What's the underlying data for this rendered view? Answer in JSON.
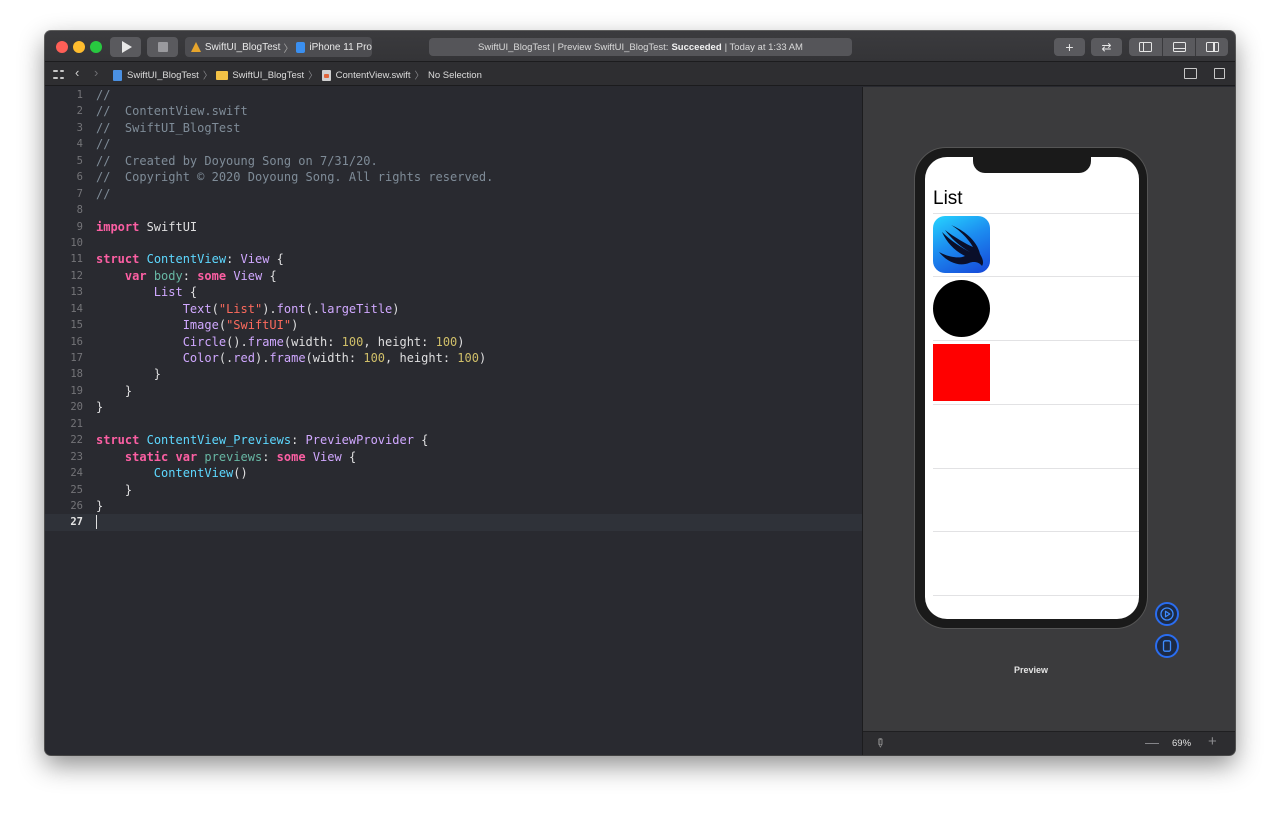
{
  "toolbar": {
    "scheme_project": "SwiftUI_BlogTest",
    "scheme_device": "iPhone 11 Pro",
    "activity_prefix": "SwiftUI_BlogTest | Preview SwiftUI_BlogTest:",
    "activity_status": "Succeeded",
    "activity_time": "| Today at 1:33 AM",
    "plus_label": "+",
    "swap_label": "⇄",
    "colors": {
      "red": "#fe5f57",
      "yellow": "#febc2e",
      "green": "#28c840"
    }
  },
  "jumpbar": {
    "back": "‹",
    "forward": "›",
    "crumbs": [
      "SwiftUI_BlogTest",
      "SwiftUI_BlogTest",
      "ContentView.swift",
      "No Selection"
    ],
    "separator": "〉"
  },
  "editor": {
    "current_line": "27",
    "lines": [
      {
        "n": "1",
        "tokens": [
          {
            "c": "c-comment",
            "t": "//"
          }
        ]
      },
      {
        "n": "2",
        "tokens": [
          {
            "c": "c-comment",
            "t": "//  ContentView.swift"
          }
        ]
      },
      {
        "n": "3",
        "tokens": [
          {
            "c": "c-comment",
            "t": "//  SwiftUI_BlogTest"
          }
        ]
      },
      {
        "n": "4",
        "tokens": [
          {
            "c": "c-comment",
            "t": "//"
          }
        ]
      },
      {
        "n": "5",
        "tokens": [
          {
            "c": "c-comment",
            "t": "//  Created by Doyoung Song on 7/31/20."
          }
        ]
      },
      {
        "n": "6",
        "tokens": [
          {
            "c": "c-comment",
            "t": "//  Copyright © 2020 Doyoung Song. All rights reserved."
          }
        ]
      },
      {
        "n": "7",
        "tokens": [
          {
            "c": "c-comment",
            "t": "//"
          }
        ]
      },
      {
        "n": "8",
        "tokens": []
      },
      {
        "n": "9",
        "tokens": [
          {
            "c": "c-kw",
            "t": "import"
          },
          {
            "c": "c-plain",
            "t": " SwiftUI"
          }
        ]
      },
      {
        "n": "10",
        "tokens": []
      },
      {
        "n": "11",
        "tokens": [
          {
            "c": "c-kw",
            "t": "struct"
          },
          {
            "c": "c-plain",
            "t": " "
          },
          {
            "c": "c-type",
            "t": "ContentView"
          },
          {
            "c": "c-plain",
            "t": ": "
          },
          {
            "c": "c-sys",
            "t": "View"
          },
          {
            "c": "c-plain",
            "t": " {"
          }
        ]
      },
      {
        "n": "12",
        "tokens": [
          {
            "c": "c-plain",
            "t": "    "
          },
          {
            "c": "c-kw",
            "t": "var"
          },
          {
            "c": "c-plain",
            "t": " "
          },
          {
            "c": "c-prop",
            "t": "body"
          },
          {
            "c": "c-plain",
            "t": ": "
          },
          {
            "c": "c-kw",
            "t": "some"
          },
          {
            "c": "c-plain",
            "t": " "
          },
          {
            "c": "c-sys",
            "t": "View"
          },
          {
            "c": "c-plain",
            "t": " {"
          }
        ]
      },
      {
        "n": "13",
        "tokens": [
          {
            "c": "c-plain",
            "t": "        "
          },
          {
            "c": "c-sys",
            "t": "List"
          },
          {
            "c": "c-plain",
            "t": " {"
          }
        ]
      },
      {
        "n": "14",
        "tokens": [
          {
            "c": "c-plain",
            "t": "            "
          },
          {
            "c": "c-sys",
            "t": "Text"
          },
          {
            "c": "c-plain",
            "t": "("
          },
          {
            "c": "c-str",
            "t": "\"List\""
          },
          {
            "c": "c-plain",
            "t": ")."
          },
          {
            "c": "c-sys",
            "t": "font"
          },
          {
            "c": "c-plain",
            "t": "(."
          },
          {
            "c": "c-sys",
            "t": "largeTitle"
          },
          {
            "c": "c-plain",
            "t": ")"
          }
        ]
      },
      {
        "n": "15",
        "tokens": [
          {
            "c": "c-plain",
            "t": "            "
          },
          {
            "c": "c-sys",
            "t": "Image"
          },
          {
            "c": "c-plain",
            "t": "("
          },
          {
            "c": "c-str",
            "t": "\"SwiftUI\""
          },
          {
            "c": "c-plain",
            "t": ")"
          }
        ]
      },
      {
        "n": "16",
        "tokens": [
          {
            "c": "c-plain",
            "t": "            "
          },
          {
            "c": "c-sys",
            "t": "Circle"
          },
          {
            "c": "c-plain",
            "t": "()."
          },
          {
            "c": "c-sys",
            "t": "frame"
          },
          {
            "c": "c-plain",
            "t": "(width: "
          },
          {
            "c": "c-num",
            "t": "100"
          },
          {
            "c": "c-plain",
            "t": ", height: "
          },
          {
            "c": "c-num",
            "t": "100"
          },
          {
            "c": "c-plain",
            "t": ")"
          }
        ]
      },
      {
        "n": "17",
        "tokens": [
          {
            "c": "c-plain",
            "t": "            "
          },
          {
            "c": "c-sys",
            "t": "Color"
          },
          {
            "c": "c-plain",
            "t": "(."
          },
          {
            "c": "c-sys",
            "t": "red"
          },
          {
            "c": "c-plain",
            "t": ")."
          },
          {
            "c": "c-sys",
            "t": "frame"
          },
          {
            "c": "c-plain",
            "t": "(width: "
          },
          {
            "c": "c-num",
            "t": "100"
          },
          {
            "c": "c-plain",
            "t": ", height: "
          },
          {
            "c": "c-num",
            "t": "100"
          },
          {
            "c": "c-plain",
            "t": ")"
          }
        ]
      },
      {
        "n": "18",
        "tokens": [
          {
            "c": "c-plain",
            "t": "        }"
          }
        ]
      },
      {
        "n": "19",
        "tokens": [
          {
            "c": "c-plain",
            "t": "    }"
          }
        ]
      },
      {
        "n": "20",
        "tokens": [
          {
            "c": "c-plain",
            "t": "}"
          }
        ]
      },
      {
        "n": "21",
        "tokens": []
      },
      {
        "n": "22",
        "tokens": [
          {
            "c": "c-kw",
            "t": "struct"
          },
          {
            "c": "c-plain",
            "t": " "
          },
          {
            "c": "c-type",
            "t": "ContentView_Previews"
          },
          {
            "c": "c-plain",
            "t": ": "
          },
          {
            "c": "c-sys",
            "t": "PreviewProvider"
          },
          {
            "c": "c-plain",
            "t": " {"
          }
        ]
      },
      {
        "n": "23",
        "tokens": [
          {
            "c": "c-plain",
            "t": "    "
          },
          {
            "c": "c-kw",
            "t": "static"
          },
          {
            "c": "c-plain",
            "t": " "
          },
          {
            "c": "c-kw",
            "t": "var"
          },
          {
            "c": "c-plain",
            "t": " "
          },
          {
            "c": "c-prop",
            "t": "previews"
          },
          {
            "c": "c-plain",
            "t": ": "
          },
          {
            "c": "c-kw",
            "t": "some"
          },
          {
            "c": "c-plain",
            "t": " "
          },
          {
            "c": "c-sys",
            "t": "View"
          },
          {
            "c": "c-plain",
            "t": " {"
          }
        ]
      },
      {
        "n": "24",
        "tokens": [
          {
            "c": "c-plain",
            "t": "        "
          },
          {
            "c": "c-type",
            "t": "ContentView"
          },
          {
            "c": "c-plain",
            "t": "()"
          }
        ]
      },
      {
        "n": "25",
        "tokens": [
          {
            "c": "c-plain",
            "t": "    }"
          }
        ]
      },
      {
        "n": "26",
        "tokens": [
          {
            "c": "c-plain",
            "t": "}"
          }
        ]
      },
      {
        "n": "27",
        "tokens": []
      }
    ]
  },
  "preview": {
    "list_title": "List",
    "label": "Preview",
    "zoom": "69%",
    "zoom_minus": "—",
    "zoom_plus": "+",
    "shape_colors": {
      "circle": "#000000",
      "square": "#ff0000"
    }
  }
}
